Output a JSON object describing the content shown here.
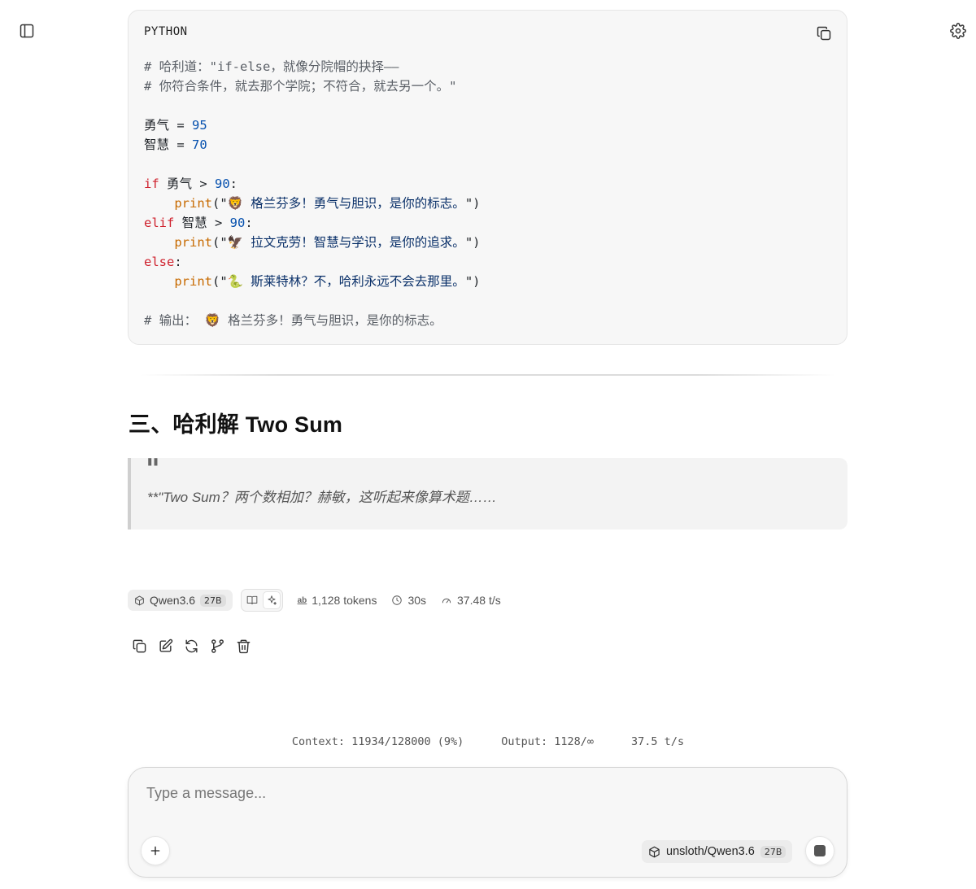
{
  "code_block": {
    "language": "PYTHON",
    "lines": [
      [
        {
          "t": "# 哈利道：\"if-else，就像分院帽的抉择——",
          "c": "c"
        }
      ],
      [
        {
          "t": "# 你符合条件，就去那个学院；不符合，就去另一个。\"",
          "c": "c"
        }
      ],
      [],
      [
        {
          "t": "勇气 = ",
          "c": "p"
        },
        {
          "t": "95",
          "c": "n"
        }
      ],
      [
        {
          "t": "智慧 = ",
          "c": "p"
        },
        {
          "t": "70",
          "c": "n"
        }
      ],
      [],
      [
        {
          "t": "if",
          "c": "k"
        },
        {
          "t": " 勇气 > ",
          "c": "p"
        },
        {
          "t": "90",
          "c": "n"
        },
        {
          "t": ":",
          "c": "p"
        }
      ],
      [
        {
          "t": "    ",
          "c": "p"
        },
        {
          "t": "print",
          "c": "f"
        },
        {
          "t": "(\"",
          "c": "p"
        },
        {
          "t": "🦁 格兰芬多！勇气与胆识，是你的标志。",
          "c": "s"
        },
        {
          "t": "\")",
          "c": "p"
        }
      ],
      [
        {
          "t": "elif",
          "c": "k"
        },
        {
          "t": " 智慧 > ",
          "c": "p"
        },
        {
          "t": "90",
          "c": "n"
        },
        {
          "t": ":",
          "c": "p"
        }
      ],
      [
        {
          "t": "    ",
          "c": "p"
        },
        {
          "t": "print",
          "c": "f"
        },
        {
          "t": "(\"",
          "c": "p"
        },
        {
          "t": "🦅 拉文克劳！智慧与学识，是你的追求。",
          "c": "s"
        },
        {
          "t": "\")",
          "c": "p"
        }
      ],
      [
        {
          "t": "else",
          "c": "k"
        },
        {
          "t": ":",
          "c": "p"
        }
      ],
      [
        {
          "t": "    ",
          "c": "p"
        },
        {
          "t": "print",
          "c": "f"
        },
        {
          "t": "(\"",
          "c": "p"
        },
        {
          "t": "🐍 斯莱特林？不，哈利永远不会去那里。",
          "c": "s"
        },
        {
          "t": "\")",
          "c": "p"
        }
      ],
      [],
      [
        {
          "t": "# 输出： 🦁 格兰芬多！勇气与胆识，是你的标志。",
          "c": "c"
        }
      ]
    ]
  },
  "section_heading": "三、哈利解 Two Sum",
  "blockquote": {
    "mark": "\"",
    "text": "**\"Two Sum？两个数相加？赫敏，这听起来像算术题……"
  },
  "message_meta": {
    "model_name": "Qwen3.6",
    "model_size": "27B",
    "tokens": "1,128 tokens",
    "duration": "30s",
    "speed": "37.48 t/s"
  },
  "status_bar": {
    "context": "Context: 11934/128000 (9%)",
    "output": "Output: 1128/∞",
    "speed": "37.5 t/s"
  },
  "composer": {
    "placeholder": "Type a message...",
    "model_name": "unsloth/Qwen3.6",
    "model_size": "27B"
  },
  "icons": {
    "sidebar": "sidebar-toggle-icon",
    "settings": "gear-icon",
    "copy": "copy-icon",
    "edit": "edit-icon",
    "regenerate": "refresh-icon",
    "branch": "git-branch-icon",
    "delete": "trash-icon",
    "stop": "stop-icon",
    "add": "plus-icon"
  }
}
